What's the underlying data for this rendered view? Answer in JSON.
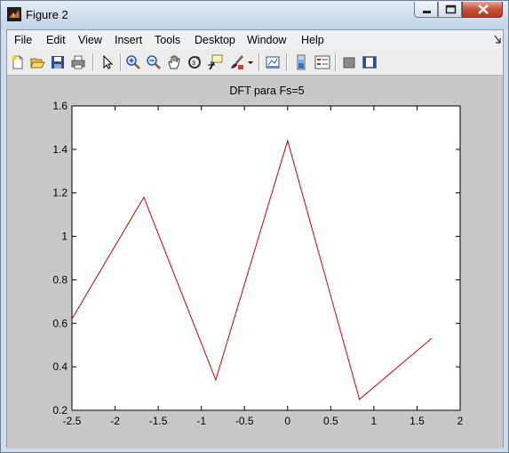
{
  "window": {
    "title": "Figure 2"
  },
  "menubar": {
    "items": [
      "File",
      "Edit",
      "View",
      "Insert",
      "Tools",
      "Desktop",
      "Window",
      "Help"
    ]
  },
  "toolbar": {
    "icons": [
      "new-figure-icon",
      "open-file-icon",
      "save-icon",
      "print-icon",
      "edit-plot-arrow-icon",
      "zoom-in-icon",
      "zoom-out-icon",
      "pan-hand-icon",
      "rotate-3d-icon",
      "data-cursor-icon",
      "brush-icon",
      "brush-dropdown-icon",
      "link-plot-icon",
      "colorbar-icon",
      "legend-icon",
      "hide-plot-tools-icon",
      "show-plot-tools-icon"
    ]
  },
  "chart_data": {
    "type": "line",
    "title": "DFT para Fs=5",
    "xlabel": "",
    "ylabel": "",
    "xlim": [
      -2.5,
      2
    ],
    "ylim": [
      0.2,
      1.6
    ],
    "xticks": [
      "-2.5",
      "-2",
      "-1.5",
      "-1",
      "-0.5",
      "0",
      "0.5",
      "1",
      "1.5",
      "2"
    ],
    "yticks": [
      "0.2",
      "0.4",
      "0.6",
      "0.8",
      "1",
      "1.2",
      "1.4",
      "1.6"
    ],
    "series": [
      {
        "color": "#cc0000",
        "x": [
          -2.5,
          -1.667,
          -0.833,
          0,
          0.833,
          1.667
        ],
        "y": [
          0.62,
          1.18,
          0.34,
          1.44,
          0.25,
          0.53
        ]
      }
    ],
    "grid": false
  }
}
